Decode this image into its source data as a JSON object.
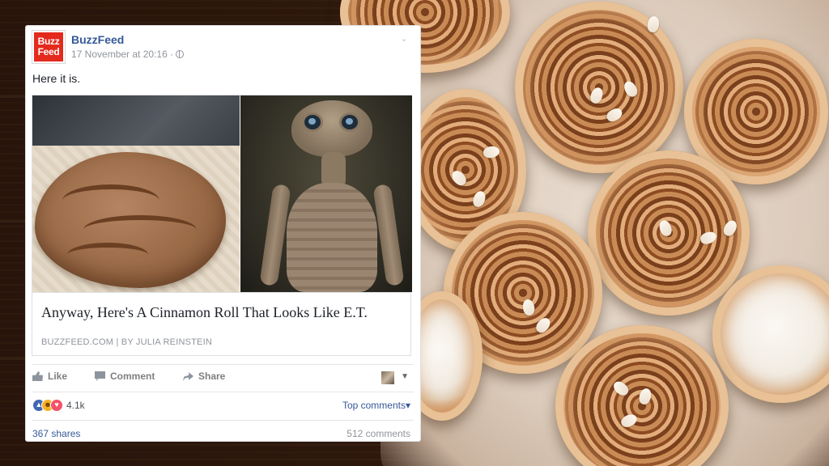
{
  "post": {
    "page_name": "BuzzFeed",
    "logo_line1": "Buzz",
    "logo_line2": "Feed",
    "timestamp": "17 November at 20:16 ·",
    "text": "Here it is."
  },
  "link": {
    "title": "Anyway, Here's A Cinnamon Roll That Looks Like E.T.",
    "domain": "BUZZFEED.COM",
    "byline": "BY JULIA REINSTEIN",
    "separator": "|"
  },
  "actions": {
    "like": "Like",
    "comment": "Comment",
    "share": "Share"
  },
  "reactions": {
    "count": "4.1k",
    "top_comments": "Top comments"
  },
  "stats": {
    "shares": "367 shares",
    "comments": "512 comments"
  },
  "icons": {
    "globe": "globe-icon",
    "chevron": "chevron-down-icon",
    "like": "thumbs-up-icon",
    "comment": "speech-bubble-icon",
    "share": "share-arrow-icon"
  },
  "colors": {
    "brand_red": "#e32a1d",
    "link_blue": "#365899",
    "like_blue": "#4267b2",
    "muted_gray": "#90949c"
  }
}
